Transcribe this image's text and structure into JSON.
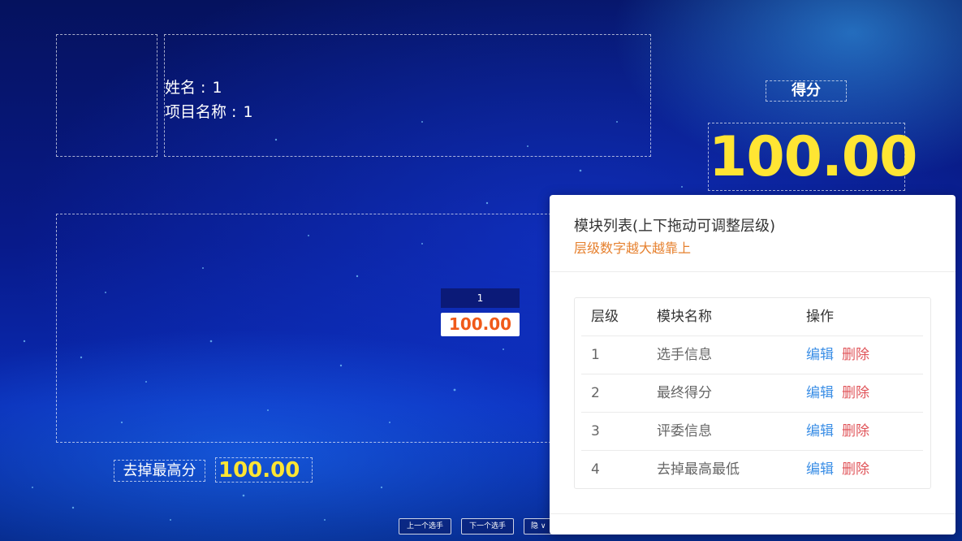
{
  "player_info": {
    "name_label": "姓名 : ",
    "name_value": "1",
    "project_label": "项目名称 : ",
    "project_value": "1"
  },
  "score": {
    "title": "得分",
    "value": "100.00"
  },
  "judge": {
    "name": "1",
    "score": "100.00"
  },
  "trimmed": {
    "label": "去掉最高分",
    "value": "100.00"
  },
  "controls": {
    "prev_label": "上一个选手",
    "next_label": "下一个选手",
    "mode_label": "隐 ∨"
  },
  "modal": {
    "title": "模块列表(上下拖动可调整层级)",
    "subtitle": "层级数字越大越靠上",
    "columns": {
      "level": "层级",
      "name": "模块名称",
      "ops": "操作"
    },
    "edit_label": "编辑",
    "delete_label": "删除",
    "rows": [
      {
        "level": "1",
        "name": "选手信息"
      },
      {
        "level": "2",
        "name": "最终得分"
      },
      {
        "level": "3",
        "name": "评委信息"
      },
      {
        "level": "4",
        "name": "去掉最高最低"
      }
    ]
  },
  "colors": {
    "accent_yellow": "#ffe533",
    "judge_score_orange": "#f05a1a",
    "subtitle_orange": "#e6802e",
    "link_blue": "#3a8ee6",
    "delete_red": "#e0555a"
  }
}
